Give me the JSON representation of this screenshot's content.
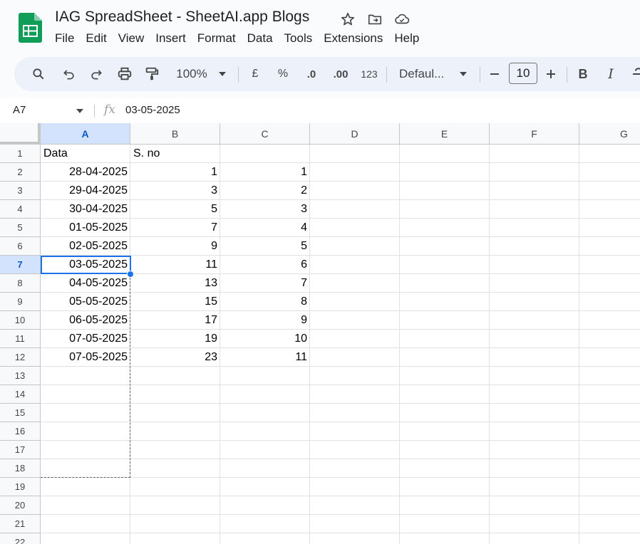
{
  "doc": {
    "title": "IAG SpreadSheet - SheetAI.app Blogs"
  },
  "menu": [
    "File",
    "Edit",
    "View",
    "Insert",
    "Format",
    "Data",
    "Tools",
    "Extensions",
    "Help"
  ],
  "toolbar": {
    "zoom": "100%",
    "currency": "£",
    "percent": "%",
    "dec_decrease": ".0",
    "dec_increase": ".00",
    "more_formats": "123",
    "font_name": "Defaul...",
    "font_size": "10",
    "bold": "B",
    "italic": "I"
  },
  "formula_bar": {
    "cell_ref": "A7",
    "value": "03-05-2025"
  },
  "sheet": {
    "columns": [
      "A",
      "B",
      "C",
      "D",
      "E",
      "F",
      "G"
    ],
    "rows": [
      "1",
      "2",
      "3",
      "4",
      "5",
      "6",
      "7",
      "8",
      "9",
      "10",
      "11",
      "12",
      "13",
      "14",
      "15",
      "16",
      "17",
      "18",
      "19",
      "20",
      "21",
      "22"
    ],
    "selected_cell": "A7",
    "cells": [
      [
        "Data",
        "S. no",
        ""
      ],
      [
        "28-04-2025",
        "1",
        "1"
      ],
      [
        "29-04-2025",
        "3",
        "2"
      ],
      [
        "30-04-2025",
        "5",
        "3"
      ],
      [
        "01-05-2025",
        "7",
        "4"
      ],
      [
        "02-05-2025",
        "9",
        "5"
      ],
      [
        "03-05-2025",
        "11",
        "6"
      ],
      [
        "04-05-2025",
        "13",
        "7"
      ],
      [
        "05-05-2025",
        "15",
        "8"
      ],
      [
        "06-05-2025",
        "17",
        "9"
      ],
      [
        "07-05-2025",
        "19",
        "10"
      ],
      [
        "07-05-2025",
        "23",
        "11"
      ]
    ]
  },
  "colors": {
    "accent": "#1a73e8",
    "header_selected": "#d3e3fd",
    "toolbar_bg": "#edf2fa",
    "logo_green": "#0f9d58"
  }
}
